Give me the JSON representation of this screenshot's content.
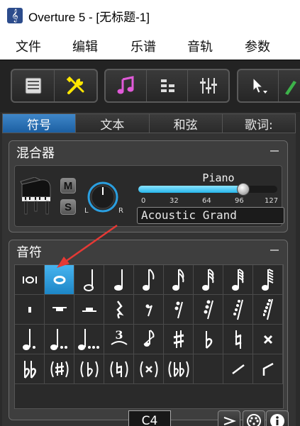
{
  "window": {
    "title": "Overture 5 - [无标题-1]"
  },
  "menu": [
    "文件",
    "编辑",
    "乐谱",
    "音轨",
    "参数"
  ],
  "tabs": [
    "符号",
    "文本",
    "和弦",
    "歌词:"
  ],
  "mixer": {
    "title": "混合器",
    "mute_label": "M",
    "solo_label": "S",
    "pan_left": "L",
    "pan_right": "R",
    "instrument": "Piano",
    "volume_ticks": [
      "0",
      "32",
      "64",
      "96",
      "127"
    ],
    "volume_value": 96,
    "volume_max": 127,
    "patch": "Acoustic Grand"
  },
  "notes": {
    "title": "音符",
    "pitch": "C4"
  },
  "colors": {
    "accent": "#1d86c7",
    "slider": "#27b5ea",
    "arrow": "#e53935"
  }
}
